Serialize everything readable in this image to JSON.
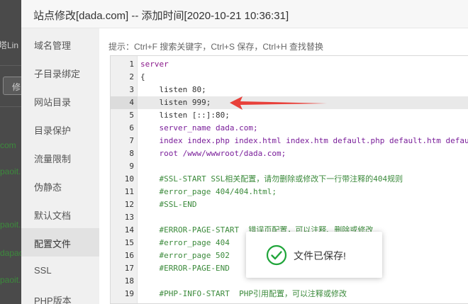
{
  "background": {
    "fragments": [
      "塔Lin",
      "修",
      "com",
      "paoit.",
      "paoit.",
      "dapac",
      "paoit."
    ]
  },
  "dialog": {
    "title": "站点修改[dada.com] -- 添加时间[2020-10-21 10:36:31]",
    "sidebar": [
      "域名管理",
      "子目录绑定",
      "网站目录",
      "目录保护",
      "流量限制",
      "伪静态",
      "默认文档",
      "配置文件",
      "SSL",
      "PHP版本"
    ],
    "active_item": "配置文件",
    "hint": "提示：Ctrl+F 搜索关键字，Ctrl+S 保存，Ctrl+H 查找替换"
  },
  "editor": {
    "highlighted_line": 4,
    "lines": [
      {
        "n": "1",
        "text": "server"
      },
      {
        "n": "2",
        "text": "{"
      },
      {
        "n": "3",
        "text": "    listen 80;"
      },
      {
        "n": "4",
        "text": "    listen 999;"
      },
      {
        "n": "5",
        "text": "    listen [::]:80;"
      },
      {
        "n": "6",
        "text": "    server_name dada.com;"
      },
      {
        "n": "7",
        "text": "    index index.php index.html index.htm default.php default.htm defau"
      },
      {
        "n": "8",
        "text": "    root /www/wwwroot/dada.com;"
      },
      {
        "n": "9",
        "text": ""
      },
      {
        "n": "10",
        "text": "    #SSL-START SSL相关配置，请勿删除或修改下一行带注释的404规则"
      },
      {
        "n": "11",
        "text": "    #error_page 404/404.html;"
      },
      {
        "n": "12",
        "text": "    #SSL-END"
      },
      {
        "n": "13",
        "text": ""
      },
      {
        "n": "14",
        "text": "    #ERROR-PAGE-START  错误页配置，可以注释、删除或修改"
      },
      {
        "n": "15",
        "text": "    #error_page 404"
      },
      {
        "n": "16",
        "text": "    #error_page 502"
      },
      {
        "n": "17",
        "text": "    #ERROR-PAGE-END"
      },
      {
        "n": "18",
        "text": ""
      },
      {
        "n": "19",
        "text": "    #PHP-INFO-START  PHP引用配置，可以注释或修改"
      }
    ]
  },
  "toast": {
    "message": "文件已保存!"
  },
  "colors": {
    "arrow": "#e8403a",
    "toast_check": "#20a53a",
    "comment": "#3b8a3b",
    "keyword": "#7a1e9a"
  },
  "icons": {
    "toast": "check-circle-icon",
    "annotation": "red-arrow-icon"
  }
}
